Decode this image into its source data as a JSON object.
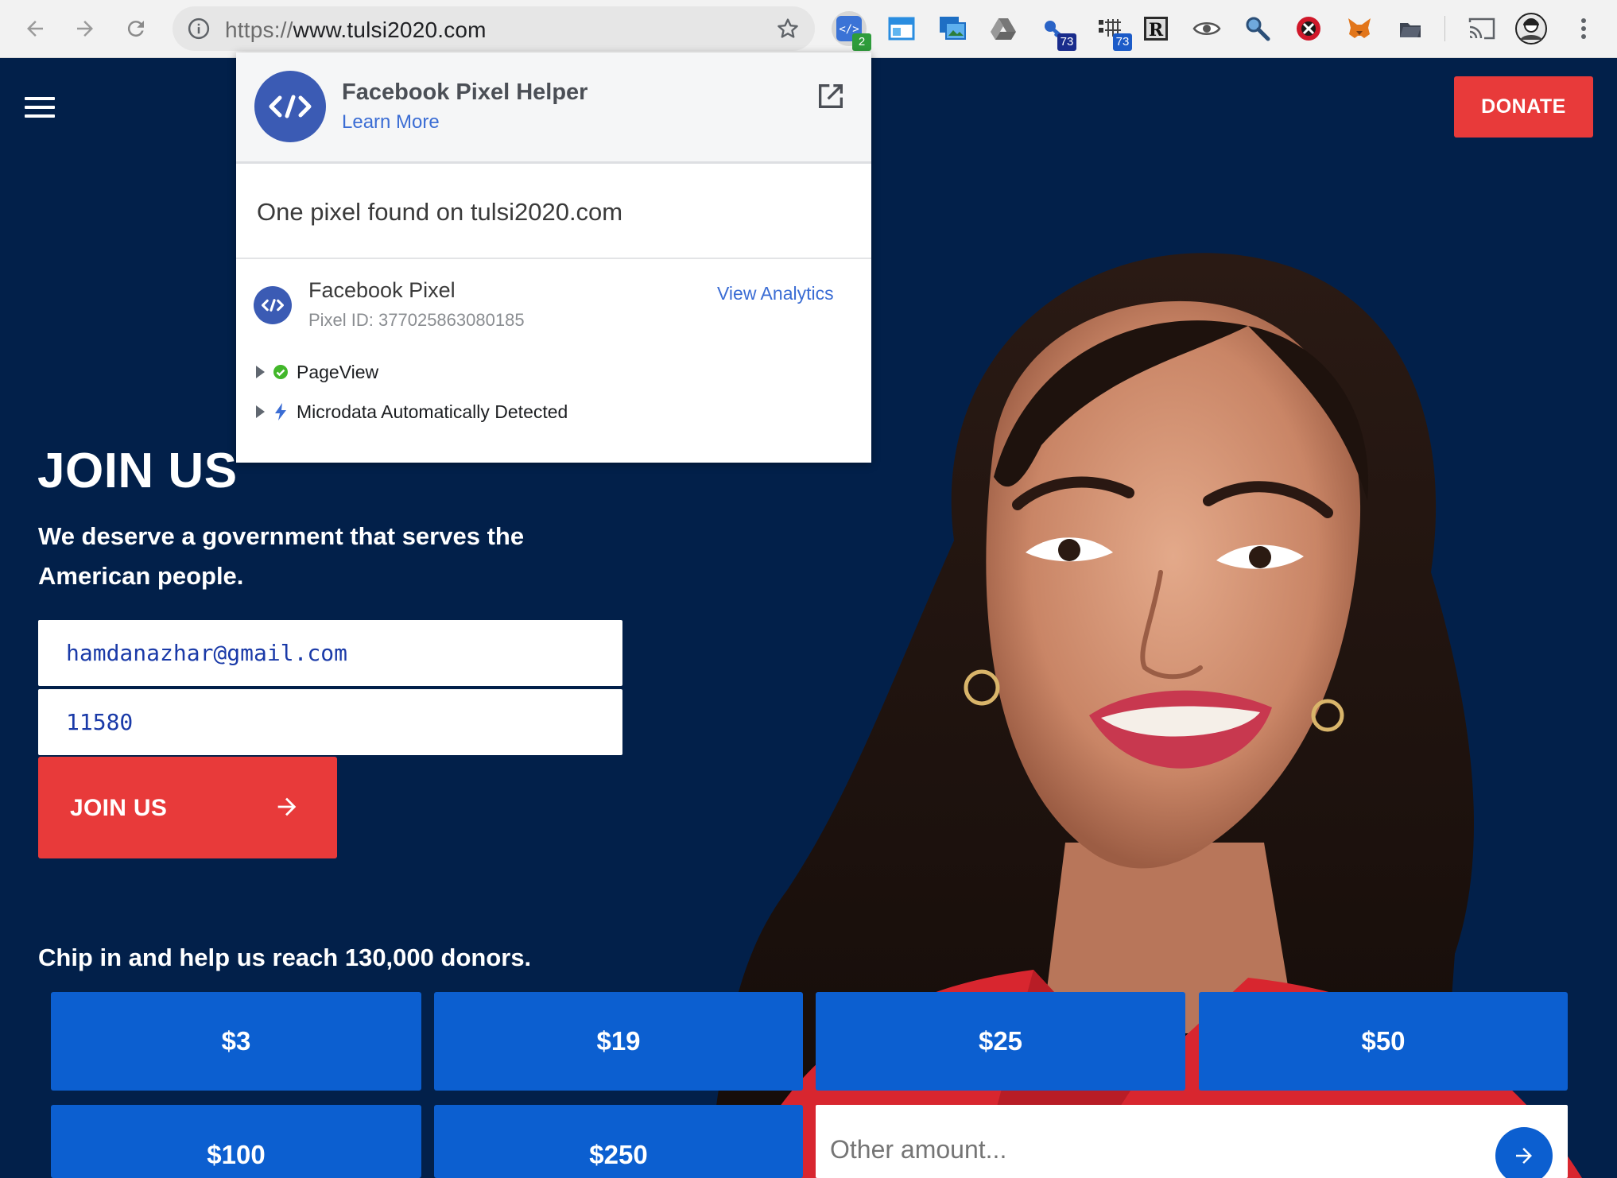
{
  "browser": {
    "url_scheme": "https://",
    "url_host": "www.tulsi2020.com",
    "extensions": [
      {
        "name": "facebook-pixel-helper",
        "badge": "2",
        "badge_color": "#2e9c3b"
      },
      {
        "name": "window-resizer",
        "badge": ""
      },
      {
        "name": "screenshot",
        "badge": ""
      },
      {
        "name": "google-drive",
        "badge": ""
      },
      {
        "name": "key",
        "badge": "73",
        "badge_color": "#1a2c8c"
      },
      {
        "name": "network",
        "badge": "73",
        "badge_color": "#1c5bc8"
      },
      {
        "name": "r-extension",
        "badge": ""
      },
      {
        "name": "eye",
        "badge": ""
      },
      {
        "name": "magnifier",
        "badge": ""
      },
      {
        "name": "blocker",
        "badge": ""
      },
      {
        "name": "metamask",
        "badge": ""
      },
      {
        "name": "folder",
        "badge": ""
      }
    ]
  },
  "popup": {
    "title": "Facebook Pixel Helper",
    "learn_more": "Learn More",
    "found_text": "One pixel found on tulsi2020.com",
    "pixel_name": "Facebook Pixel",
    "pixel_id": "Pixel ID: 377025863080185",
    "view_analytics": "View Analytics",
    "events": [
      {
        "label": "PageView",
        "icon": "check-icon",
        "color": "#42b72a"
      },
      {
        "label": "Microdata Automatically Detected",
        "icon": "lightning-icon",
        "color": "#3b6dd4"
      }
    ]
  },
  "page": {
    "donate_label": "DONATE",
    "join_title": "JOIN US",
    "join_subtitle": "We deserve a government that serves the American people.",
    "email_value": "hamdanazhar@gmail.com",
    "zip_value": "11580",
    "join_button": "JOIN US",
    "chip_text": "Chip in and help us reach 130,000 donors.",
    "amounts": [
      "$3",
      "$19",
      "$25",
      "$50",
      "$100",
      "$250"
    ],
    "other_placeholder": "Other amount...",
    "colors": {
      "background": "#02204a",
      "accent_red": "#e83a3a",
      "accent_blue": "#0c5fd0"
    }
  }
}
